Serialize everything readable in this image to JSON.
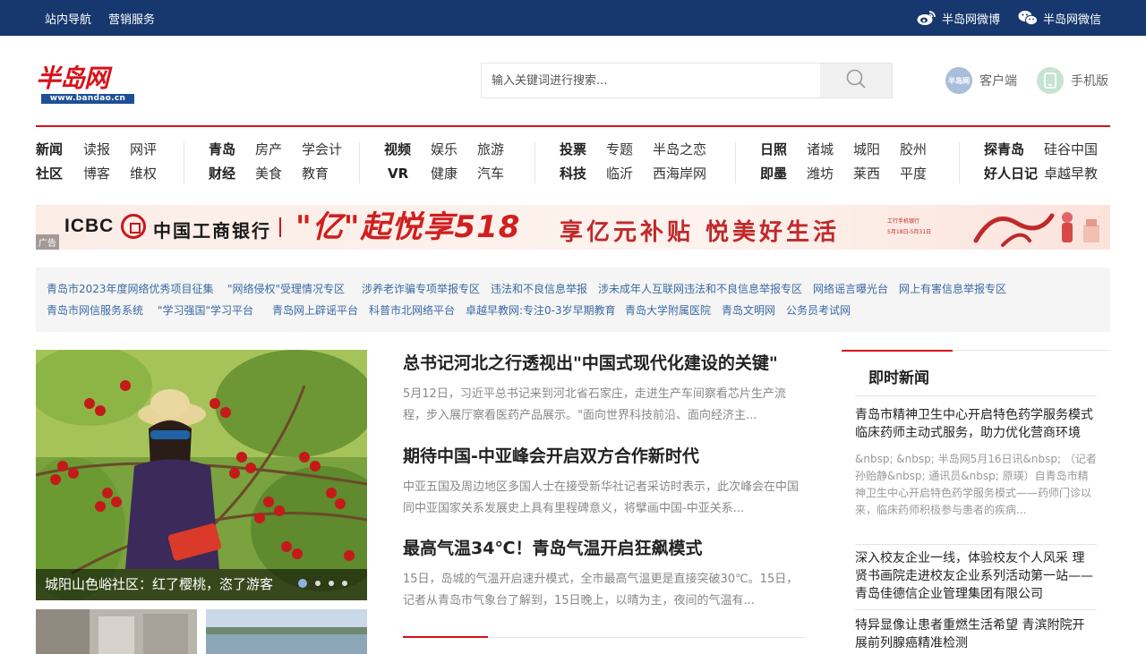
{
  "topbar": {
    "links": [
      "站内导航",
      "营销服务"
    ],
    "weibo": "半岛网微博",
    "weixin": "半岛网微信"
  },
  "header": {
    "logo_text": "半岛网",
    "logo_url": "www.bandao.cn",
    "search_placeholder": "输入关键词进行搜索...",
    "client_label": "客户端",
    "client_badge": "半岛网",
    "mobile_label": "手机版"
  },
  "nav": {
    "groups": [
      {
        "row1": [
          {
            "t": "新闻",
            "b": true
          },
          {
            "t": "读报"
          },
          {
            "t": "网评"
          }
        ],
        "row2": [
          {
            "t": "社区",
            "b": true
          },
          {
            "t": "博客"
          },
          {
            "t": "维权"
          }
        ]
      },
      {
        "row1": [
          {
            "t": "青岛",
            "b": true
          },
          {
            "t": "房产"
          },
          {
            "t": "学会计"
          }
        ],
        "row2": [
          {
            "t": "财经",
            "b": true
          },
          {
            "t": "美食"
          },
          {
            "t": "教育"
          }
        ]
      },
      {
        "row1": [
          {
            "t": "视频",
            "b": true
          },
          {
            "t": "娱乐"
          },
          {
            "t": "旅游"
          }
        ],
        "row2": [
          {
            "t": "VR",
            "b": true
          },
          {
            "t": "健康"
          },
          {
            "t": "汽车"
          }
        ]
      },
      {
        "row1": [
          {
            "t": "投票",
            "b": true
          },
          {
            "t": "专题"
          },
          {
            "t": "半岛之恋"
          }
        ],
        "row2": [
          {
            "t": "科技",
            "b": true
          },
          {
            "t": "临沂"
          },
          {
            "t": "西海岸网"
          }
        ]
      },
      {
        "row1": [
          {
            "t": "日照",
            "b": true
          },
          {
            "t": "诸城"
          },
          {
            "t": "城阳"
          },
          {
            "t": "胶州"
          }
        ],
        "row2": [
          {
            "t": "即墨",
            "b": true
          },
          {
            "t": "潍坊"
          },
          {
            "t": "莱西"
          },
          {
            "t": "平度"
          }
        ]
      },
      {
        "row1": [
          {
            "t": "探青岛",
            "b": true
          },
          {
            "t": "硅谷中国"
          }
        ],
        "row2": [
          {
            "t": "好人日记",
            "b": true
          },
          {
            "t": "卓越早教"
          }
        ]
      }
    ]
  },
  "banner": {
    "brand_en": "ICBC",
    "brand_cn": "中国工商银行",
    "promo_main": "\"亿\"起悦享518",
    "promo_sub": "享亿元补贴  悦美好生活",
    "small_line1": "工行手机银行",
    "small_line2": "5月18日-5月31日",
    "ad_tag": "广告"
  },
  "links": {
    "row1": [
      "青岛市2023年度网络优秀项目征集",
      "\"网络侵权\"受理情况专区",
      "涉养老诈骗专项举报专区",
      "违法和不良信息举报",
      "涉未成年人互联网违法和不良信息举报专区",
      "网络谣言曝光台",
      "网上有害信息举报专区"
    ],
    "row2": [
      "青岛市网信服务系统",
      "\"学习强国\"学习平台",
      "青岛网上辟谣平台",
      "科普市北网络平台",
      "卓越早教网:专注0-3岁早期教育",
      "青岛大学附属医院",
      "青岛文明网",
      "公务员考试网"
    ]
  },
  "slider": {
    "caption": "城阳山色峪社区：红了樱桃，恣了游客",
    "current": 1,
    "total": 4
  },
  "news": [
    {
      "title": "总书记河北之行透视出\"中国式现代化建设的关键\"",
      "summary": "5月12日，习近平总书记来到河北省石家庄，走进生产车间察看芯片生产流程，步入展厅察看医药产品展示。\"面向世界科技前沿、面向经济主..."
    },
    {
      "title": "期待中国-中亚峰会开启双方合作新时代",
      "summary": "中亚五国及周边地区多国人士在接受新华社记者采访时表示，此次峰会在中国同中亚国家关系发展史上具有里程碑意义，将擘画中国-中亚关系..."
    },
    {
      "title": "最高气温34℃！青岛气温开启狂飙模式",
      "summary": "15日，岛城的气温开启速升模式，全市最高气温更是直接突破30℃。15日，记者从青岛市气象台了解到，15日晚上，以晴为主，夜间的气温有..."
    }
  ],
  "sidebar": {
    "title": "即时新闻",
    "items": [
      {
        "title": "青岛市精神卫生中心开启特色药学服务模式 临床药师主动式服务，助力优化营商环境",
        "desc": "&nbsp; &nbsp; 半岛网5月16日讯&nbsp; （记者 孙贻静&nbsp; 通讯员&nbsp; 原瑛）自青岛市精神卫生中心开启特色药学服务模式——药师门诊以来，临床药师积极参与患者的疾病..."
      },
      {
        "title": "深入校友企业一线，体验校友个人风采 理贤书画院走进校友企业系列活动第一站——青岛佳德信企业管理集团有限公司"
      },
      {
        "title": "特异显像让患者重燃生活希望 青滨附院开展前列腺癌精准检测"
      }
    ]
  },
  "colors": {
    "topbar_bg": "#17386e",
    "accent_red": "#d8111a",
    "link_blue": "#3a6aa5"
  }
}
